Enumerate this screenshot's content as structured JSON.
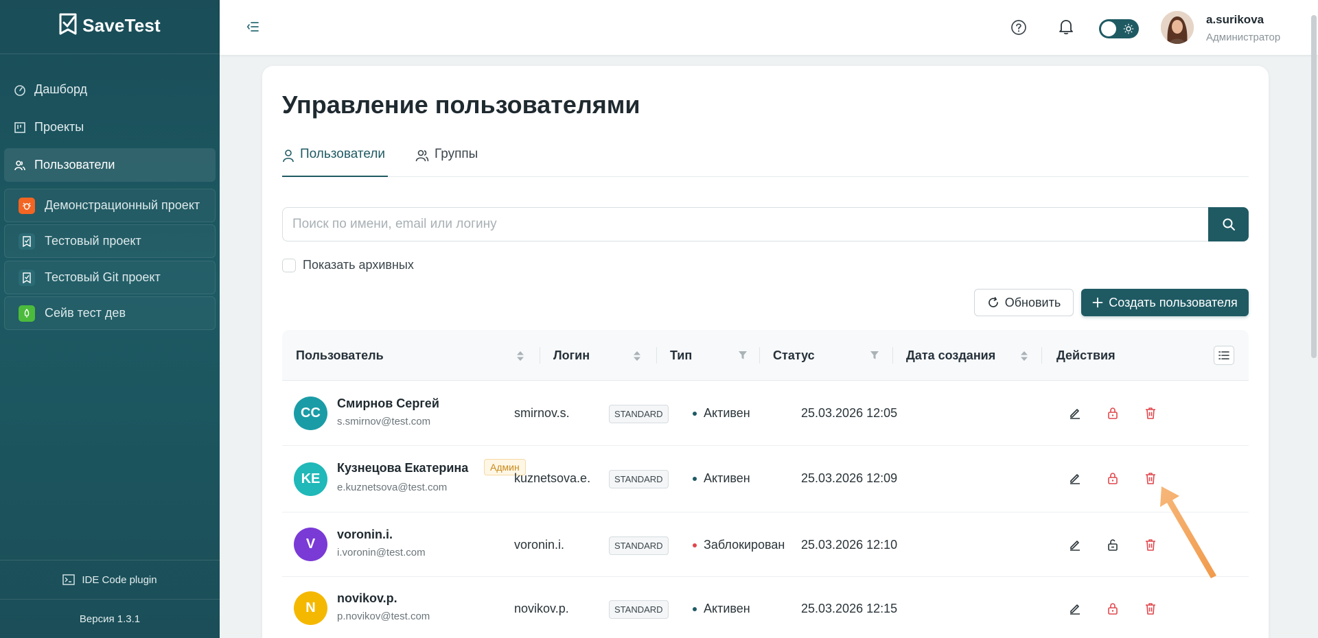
{
  "app": {
    "name": "SaveTest",
    "version": "Версия 1.3.1",
    "ide_plugin": "IDE Code plugin"
  },
  "sidebar": {
    "nav": [
      {
        "label": "Дашборд",
        "icon": "dashboard-icon"
      },
      {
        "label": "Проекты",
        "icon": "projects-icon"
      },
      {
        "label": "Пользователи",
        "icon": "users-icon",
        "active": true
      }
    ],
    "projects": [
      {
        "label": "Демонстрационный проект",
        "icon": "bug-icon",
        "color": "#f26522"
      },
      {
        "label": "Тестовый проект",
        "icon": "checklist-icon",
        "color": "#2a6b74"
      },
      {
        "label": "Тестовый Git проект",
        "icon": "checklist-icon",
        "color": "#2a6b74"
      },
      {
        "label": "Сейв тест дев",
        "icon": "rocket-icon",
        "color": "#4cbb3c"
      }
    ]
  },
  "header": {
    "user_name": "a.surikova",
    "user_role": "Администратор"
  },
  "page": {
    "title": "Управление пользователями",
    "tabs": [
      {
        "label": "Пользователи",
        "active": true
      },
      {
        "label": "Группы"
      }
    ],
    "search_placeholder": "Поиск по имени, email или логину",
    "show_archived": "Показать архивных",
    "refresh": "Обновить",
    "create": "Создать пользователя"
  },
  "table": {
    "columns": [
      "Пользователь",
      "Логин",
      "Тип",
      "Статус",
      "Дата создания",
      "Действия"
    ],
    "rows": [
      {
        "initials": "CC",
        "avatar_color": "#1a9ca6",
        "name": "Смирнов Сергей",
        "email": "s.smirnov@test.com",
        "badge": "",
        "login": "smirnov.s.",
        "type": "STANDARD",
        "status": "Активен",
        "status_color": "#1f5a63",
        "created": "25.03.2026 12:05",
        "lock_icon": "lock-icon",
        "lock_color": "#e0474c"
      },
      {
        "initials": "KE",
        "avatar_color": "#20b8b8",
        "name": "Кузнецова Екатерина",
        "email": "e.kuznetsova@test.com",
        "badge": "Админ",
        "login": "kuznetsova.e.",
        "type": "STANDARD",
        "status": "Активен",
        "status_color": "#1f5a63",
        "created": "25.03.2026 12:09",
        "lock_icon": "lock-icon",
        "lock_color": "#e0474c"
      },
      {
        "initials": "V",
        "avatar_color": "#7a3ad6",
        "name": "voronin.i.",
        "email": "i.voronin@test.com",
        "badge": "",
        "login": "voronin.i.",
        "type": "STANDARD",
        "status": "Заблокирован",
        "status_color": "#e0474c",
        "created": "25.03.2026 12:10",
        "lock_icon": "unlock-icon",
        "lock_color": "#2a3439"
      },
      {
        "initials": "N",
        "avatar_color": "#f5b800",
        "name": "novikov.p.",
        "email": "p.novikov@test.com",
        "badge": "",
        "login": "novikov.p.",
        "type": "STANDARD",
        "status": "Активен",
        "status_color": "#1f5a63",
        "created": "25.03.2026 12:15",
        "lock_icon": "lock-icon",
        "lock_color": "#e0474c"
      }
    ]
  },
  "colors": {
    "primary": "#1f5a63",
    "danger": "#e0474c",
    "annotation_arrow": "#f4a259"
  }
}
